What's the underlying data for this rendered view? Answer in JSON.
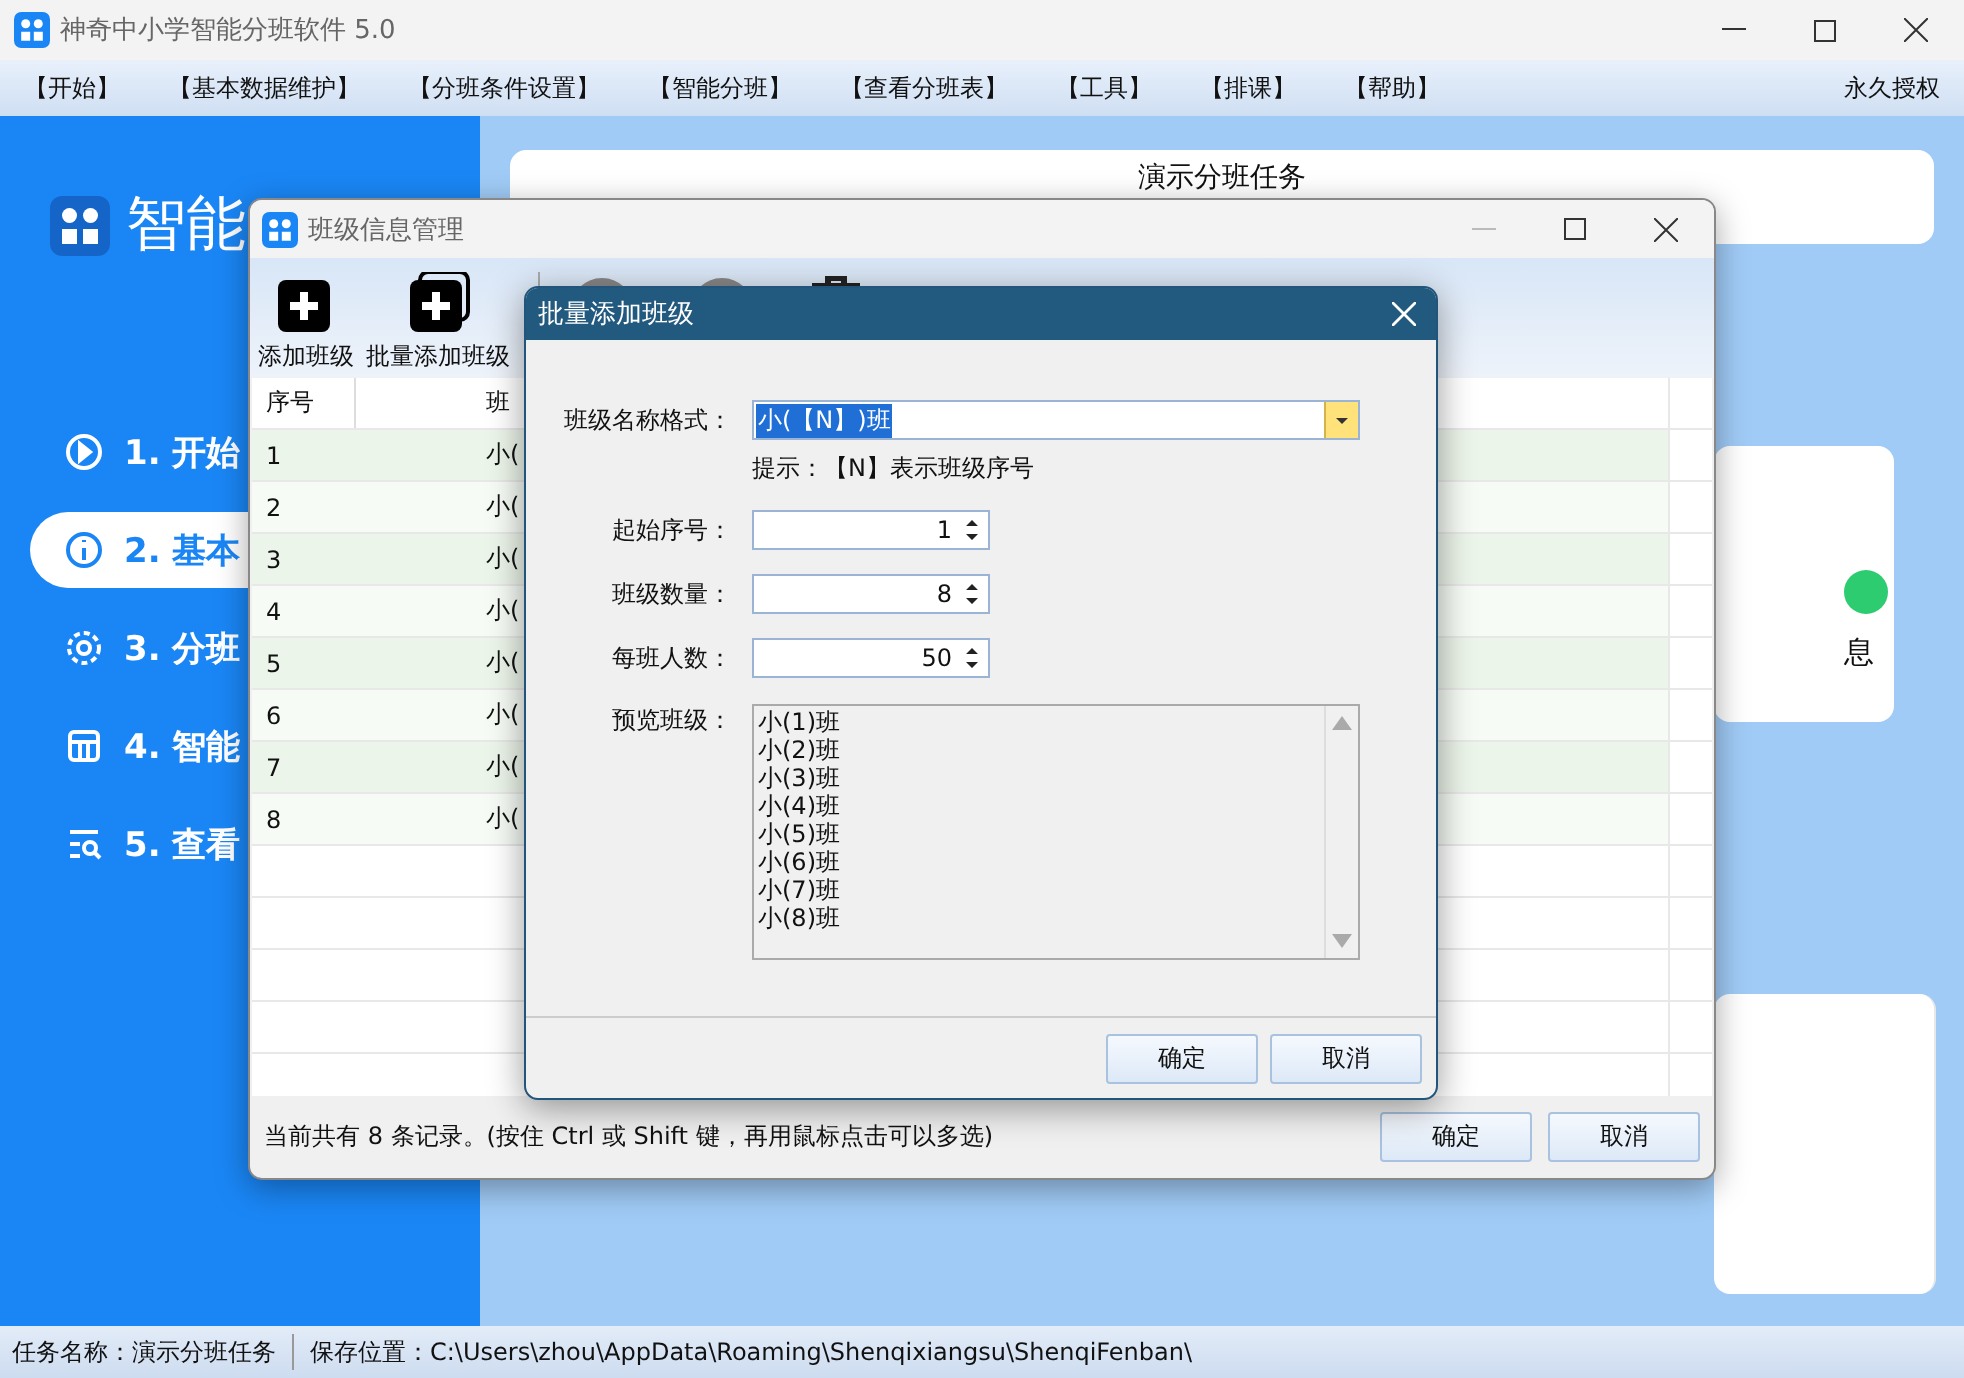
{
  "window": {
    "title": "神奇中小学智能分班软件 5.0"
  },
  "menu": {
    "items": [
      "【开始】",
      "【基本数据维护】",
      "【分班条件设置】",
      "【智能分班】",
      "【查看分班表】",
      "【工具】",
      "【排课】",
      "【帮助】"
    ],
    "license": "永久授权"
  },
  "sidebar": {
    "logo_text": "智能",
    "items": [
      {
        "label": "1. 开始",
        "selected": false
      },
      {
        "label": "2. 基本",
        "selected": true
      },
      {
        "label": "3. 分班",
        "selected": false
      },
      {
        "label": "4. 智能",
        "selected": false
      },
      {
        "label": "5. 查看",
        "selected": false
      }
    ]
  },
  "main": {
    "task_title": "演示分班任务",
    "card_text": "息"
  },
  "class_window": {
    "title": "班级信息管理",
    "toolbar": [
      {
        "label": "添加班级"
      },
      {
        "label": "批量添加班级"
      }
    ],
    "table": {
      "columns": [
        "序号",
        "班"
      ],
      "rows": [
        {
          "index": "1",
          "name": "小("
        },
        {
          "index": "2",
          "name": "小("
        },
        {
          "index": "3",
          "name": "小("
        },
        {
          "index": "4",
          "name": "小("
        },
        {
          "index": "5",
          "name": "小("
        },
        {
          "index": "6",
          "name": "小("
        },
        {
          "index": "7",
          "name": "小("
        },
        {
          "index": "8",
          "name": "小("
        }
      ]
    },
    "status_text": "当前共有 8 条记录。(按住 Ctrl 或 Shift 键，再用鼠标点击可以多选)",
    "buttons": [
      "确定",
      "取消"
    ]
  },
  "dialog": {
    "title": "批量添加班级",
    "format": {
      "label": "班级名称格式：",
      "value": "小(【N】)班",
      "value_selected": true
    },
    "hint": "提示：【N】表示班级序号",
    "spins": [
      {
        "label": "起始序号：",
        "value": "1"
      },
      {
        "label": "班级数量：",
        "value": "8"
      },
      {
        "label": "每班人数：",
        "value": "50"
      }
    ],
    "preview": {
      "label": "预览班级：",
      "items": [
        "小(1)班",
        "小(2)班",
        "小(3)班",
        "小(4)班",
        "小(5)班",
        "小(6)班",
        "小(7)班",
        "小(8)班"
      ]
    },
    "buttons": [
      "确定",
      "取消"
    ]
  },
  "status_bar": {
    "task": "任务名称：演示分班任务",
    "path": "保存位置：C:\\Users\\zhou\\AppData\\Roaming\\Shenqixiangsu\\ShenqiFenban\\"
  }
}
